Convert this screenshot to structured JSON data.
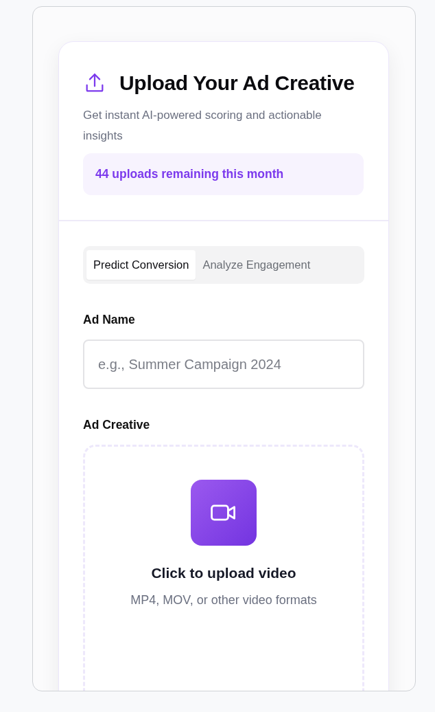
{
  "header": {
    "title": "Upload Your Ad Creative",
    "subtitle": "Get instant AI-powered scoring and actionable insights",
    "quota": "44 uploads remaining this month"
  },
  "tabs": [
    {
      "label": "Predict Conversion",
      "selected": true
    },
    {
      "label": "Analyze Engagement",
      "selected": false
    }
  ],
  "ad_name": {
    "label": "Ad Name",
    "placeholder": "e.g., Summer Campaign 2024"
  },
  "ad_creative": {
    "label": "Ad Creative",
    "prompt": "Click to upload video",
    "hint": "MP4, MOV, or other video formats"
  }
}
